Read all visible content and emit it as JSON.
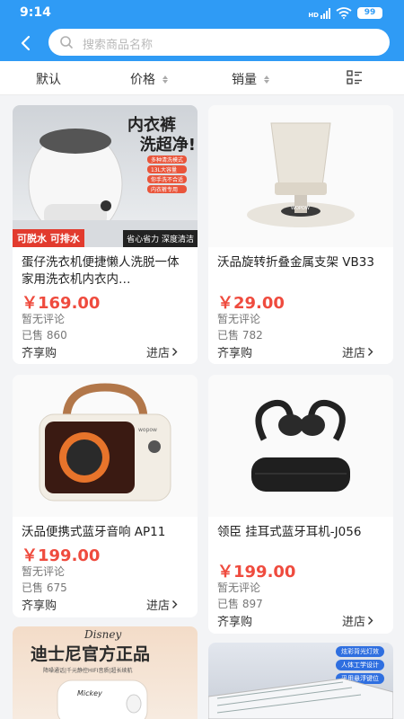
{
  "status_bar": {
    "time": "9:14",
    "battery": "99",
    "signal_label": "HD"
  },
  "search": {
    "placeholder": "搜索商品名称"
  },
  "sort_bar": {
    "default_label": "默认",
    "price_label": "价格",
    "sales_label": "销量"
  },
  "products": [
    {
      "title": "蛋仔洗衣机便捷懒人洗脱一体家用洗衣机内衣内…",
      "price": "￥169.00",
      "reviews": "暂无评论",
      "sold": "已售 860",
      "shop": "齐享购",
      "enter_label": "进店",
      "image_text": {
        "headline1": "内衣裤",
        "headline2": "洗超净!",
        "bullets": [
          "多种清洗模式",
          "13L大容量",
          "你手洗不合适",
          "内衣裤专用"
        ],
        "badge1": "可脱水 可排水",
        "badge2": "省心省力 深度清洁"
      }
    },
    {
      "title": "沃品旋转折叠金属支架 VB33",
      "price": "￥29.00",
      "reviews": "暂无评论",
      "sold": "已售 782",
      "shop": "齐享购",
      "enter_label": "进店",
      "image_text": {
        "brand": "WOPOW"
      }
    },
    {
      "title": "沃品便携式蓝牙音响 AP11",
      "price": "￥199.00",
      "reviews": "暂无评论",
      "sold": "已售 675",
      "shop": "齐享购",
      "enter_label": "进店",
      "image_text": {
        "brand": "wopow"
      }
    },
    {
      "title": "领臣 挂耳式蓝牙耳机-J056",
      "price": "￥199.00",
      "reviews": "暂无评论",
      "sold": "已售 897",
      "shop": "齐享购",
      "enter_label": "进店",
      "image_text": {}
    },
    {
      "title": "",
      "image_text": {
        "brand": "Disney",
        "headline": "迪士尼官方正品",
        "tagline": "降噪通话|千元静控HIFI音质|超长续航",
        "figure_label": "Mickey"
      }
    },
    {
      "title": "",
      "image_text": {
        "tags": [
          "炫彩背光灯效",
          "人体工学设计",
          "采用悬浮键位"
        ]
      }
    }
  ],
  "colors": {
    "primary": "#2f9bf5",
    "price": "#ef4b3e",
    "background": "#f3f4f6"
  }
}
